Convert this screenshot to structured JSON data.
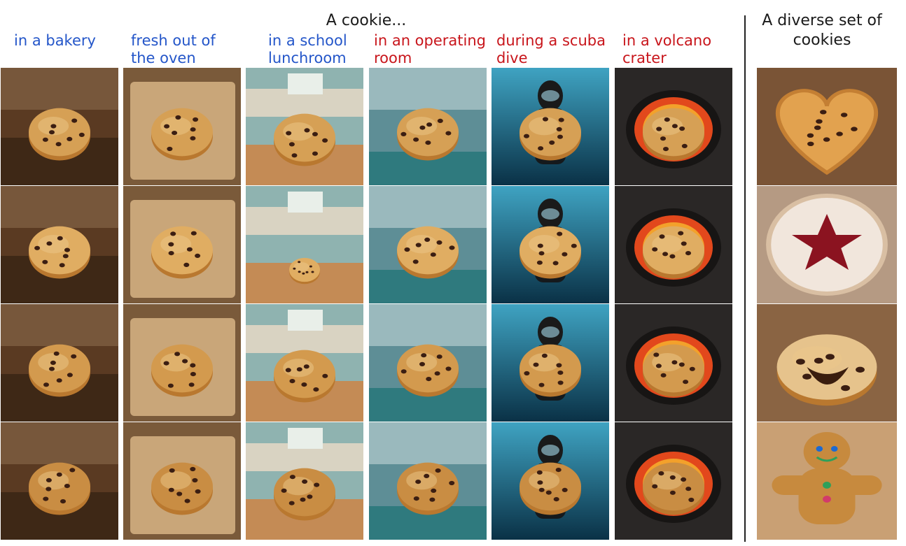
{
  "main_title": "A cookie...",
  "side_title": "A diverse set of cookies",
  "columns": [
    {
      "label": "in a bakery",
      "color": "#2456c9",
      "theme": "bakery"
    },
    {
      "label": "fresh out of the oven",
      "color": "#2456c9",
      "theme": "oven"
    },
    {
      "label": "in a school lunchroom",
      "color": "#2456c9",
      "theme": "school"
    },
    {
      "label": "in an operating room",
      "color": "#c8151b",
      "theme": "operating"
    },
    {
      "label": "during a scuba dive",
      "color": "#c8151b",
      "theme": "scuba"
    },
    {
      "label": "in a volcano crater",
      "color": "#c8151b",
      "theme": "volcano"
    }
  ],
  "diverse": [
    "heart-raisin-cookie",
    "star-jam-linzer-cookie",
    "chocolate-lava-cookie",
    "gingerbread-man-cookie"
  ]
}
